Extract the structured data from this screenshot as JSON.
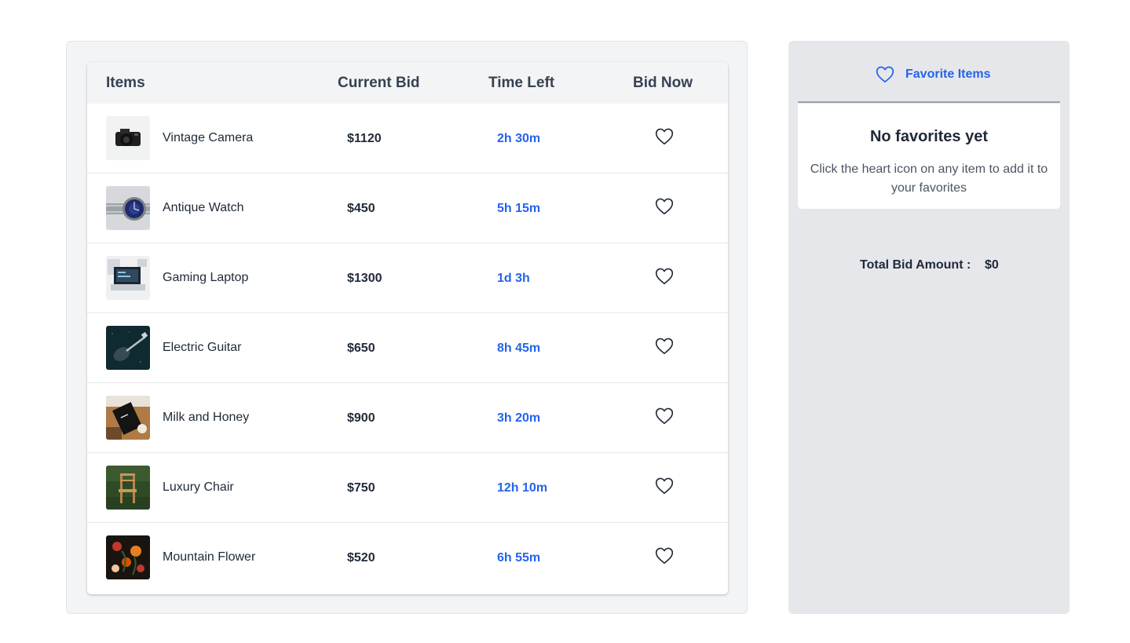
{
  "table": {
    "headers": {
      "items": "Items",
      "current_bid": "Current Bid",
      "time_left": "Time Left",
      "bid_now": "Bid Now"
    },
    "rows": [
      {
        "name": "Vintage Camera",
        "bid": "$1120",
        "time": "2h 30m",
        "image": "camera-photo"
      },
      {
        "name": "Antique Watch",
        "bid": "$450",
        "time": "5h 15m",
        "image": "watch-photo"
      },
      {
        "name": "Gaming Laptop",
        "bid": "$1300",
        "time": "1d 3h",
        "image": "laptop-photo"
      },
      {
        "name": "Electric Guitar",
        "bid": "$650",
        "time": "8h 45m",
        "image": "guitar-photo"
      },
      {
        "name": "Milk and Honey",
        "bid": "$900",
        "time": "3h 20m",
        "image": "book-photo"
      },
      {
        "name": "Luxury Chair",
        "bid": "$750",
        "time": "12h 10m",
        "image": "chair-photo"
      },
      {
        "name": "Mountain Flower",
        "bid": "$520",
        "time": "6h 55m",
        "image": "flower-photo"
      }
    ],
    "action_icon": "heart-outline-icon"
  },
  "favorites": {
    "title": "Favorite Items",
    "icon": "heart-outline-icon",
    "empty_title": "No favorites yet",
    "empty_text": "Click the heart icon on any item to add it to your favorites"
  },
  "total": {
    "label": "Total Bid Amount :",
    "value": "$0"
  },
  "colors": {
    "accent": "#2563eb",
    "panel_bg": "#f3f4f6",
    "sidebar_bg": "#e5e7eb"
  }
}
